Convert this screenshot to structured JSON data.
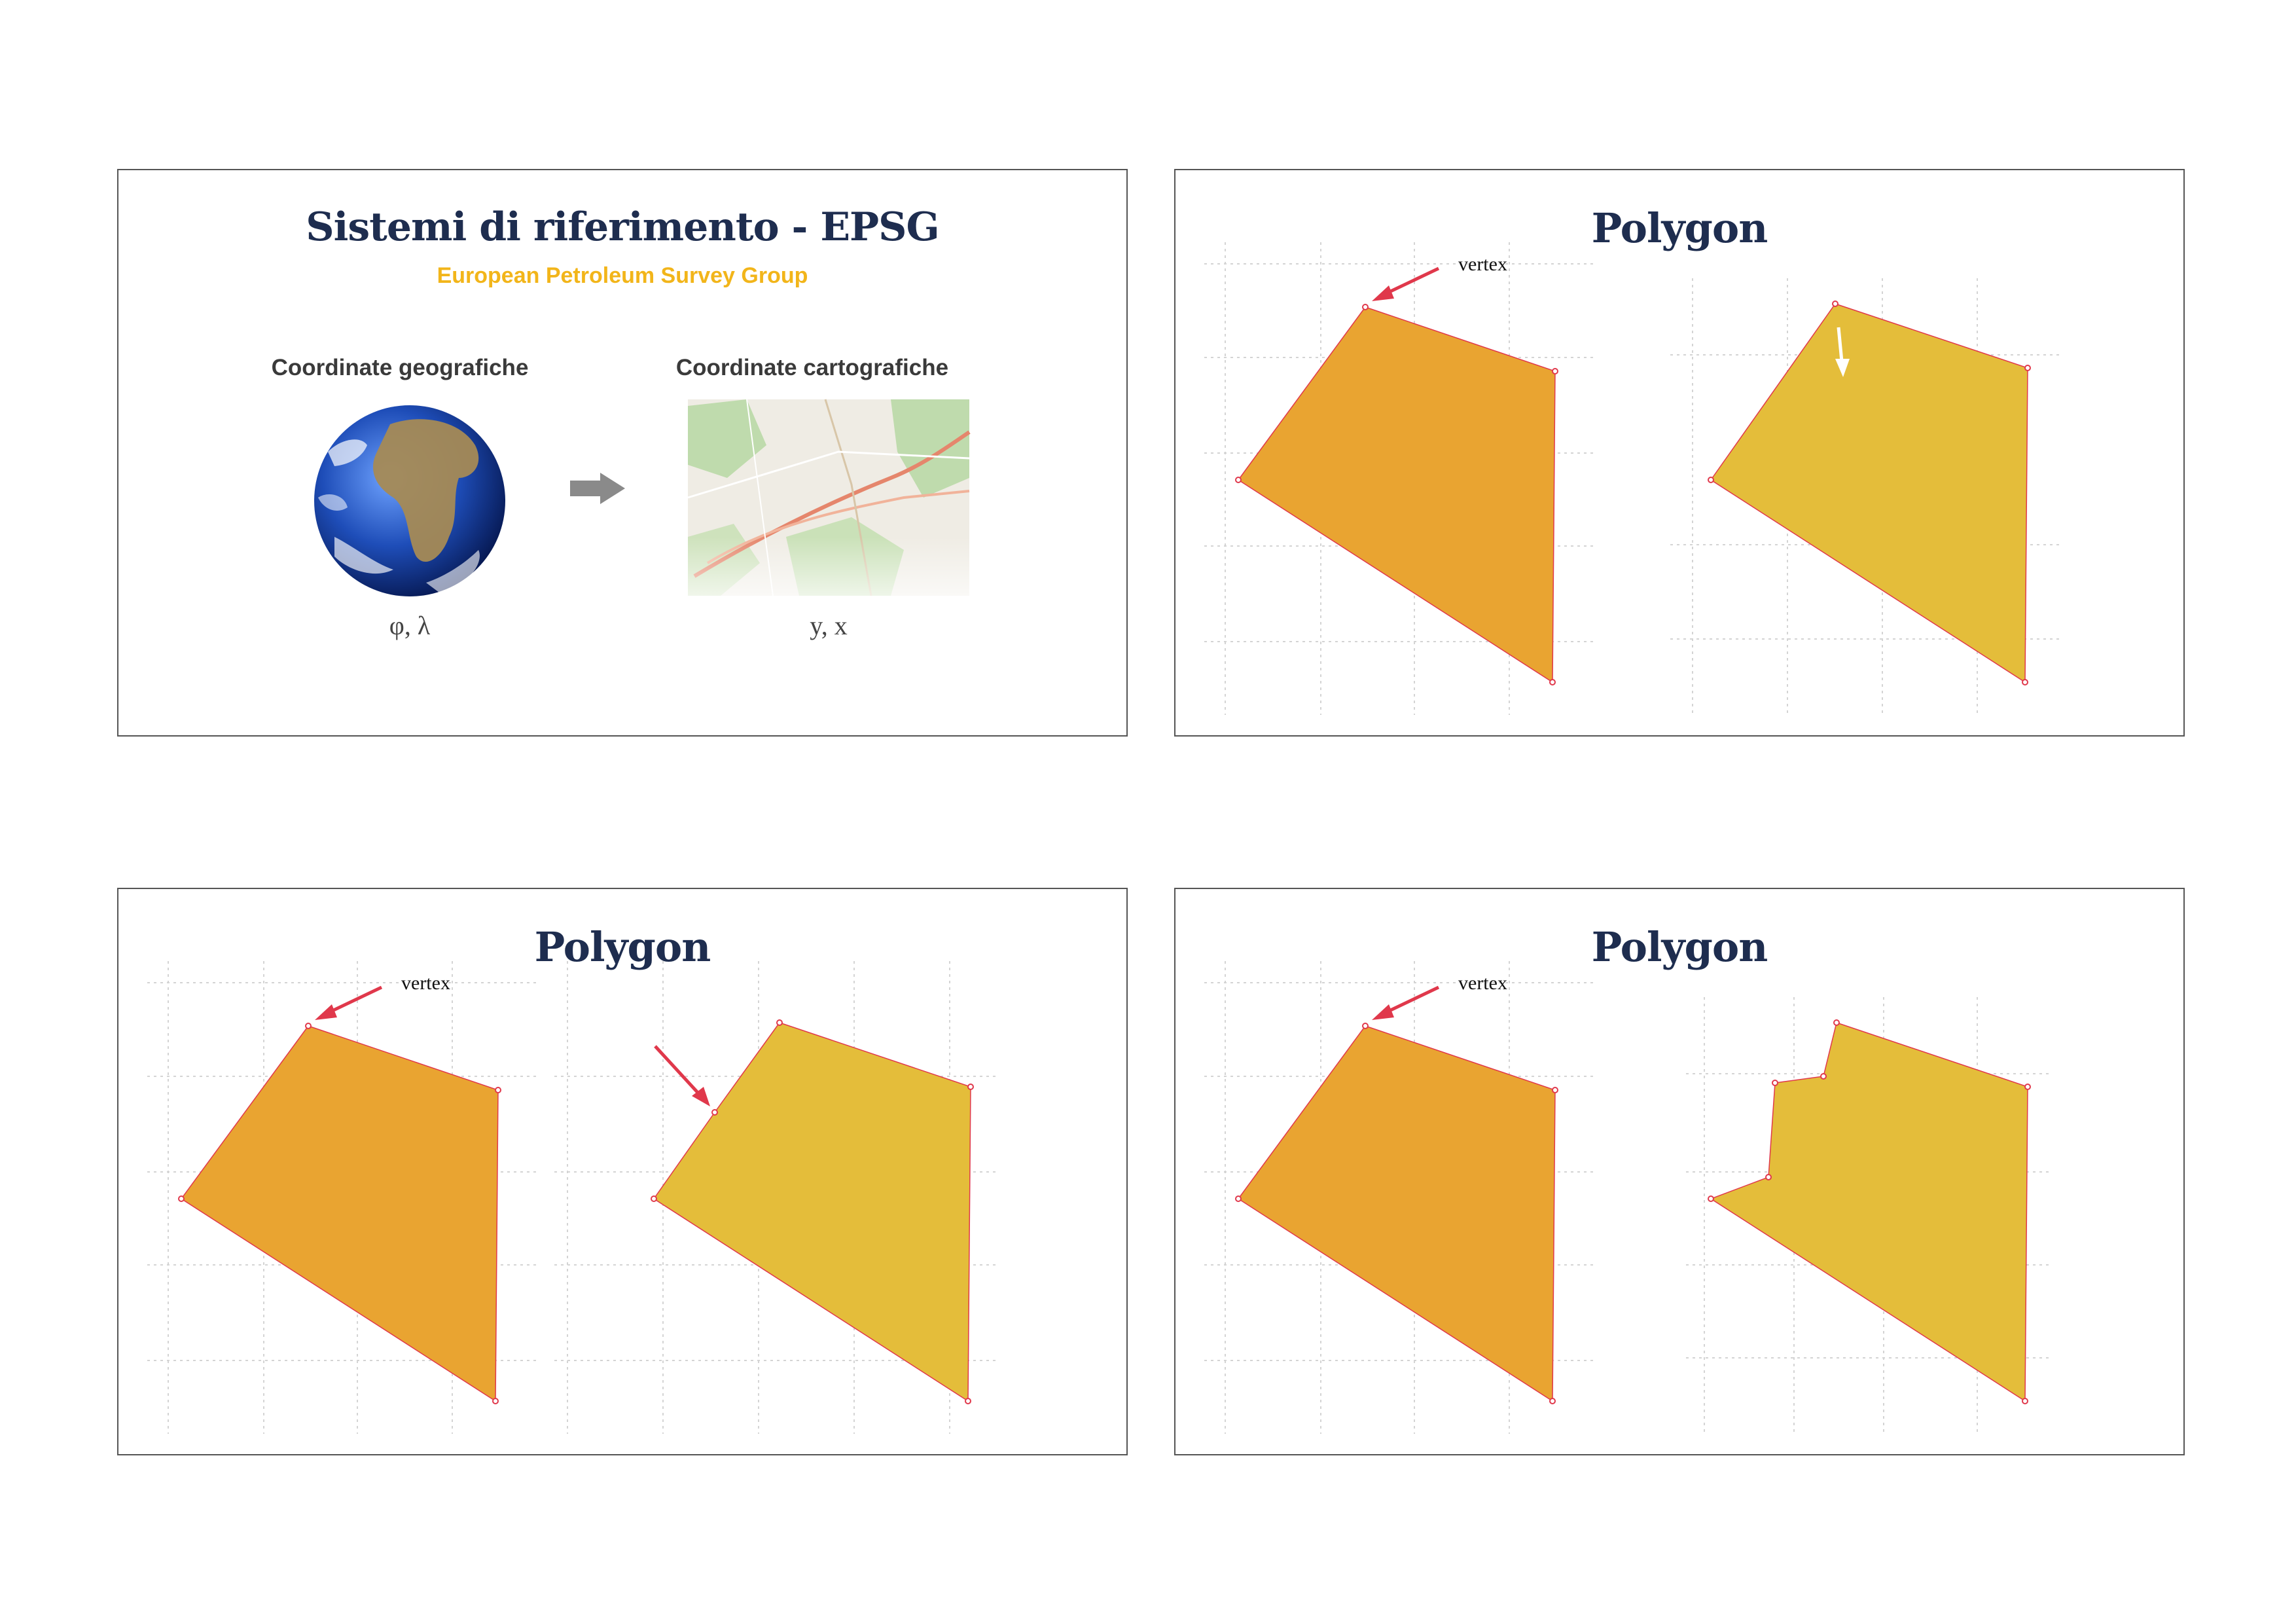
{
  "slides": [
    {
      "title": "Sistemi di riferimento - EPSG",
      "subtitle": "European Petroleum Survey Group",
      "left_heading": "Coordinate geografiche",
      "right_heading": "Coordinate cartografiche",
      "left_coords": "φ, λ",
      "right_coords": "y, x"
    },
    {
      "title": "Polygon",
      "vertex_label": "vertex"
    },
    {
      "title": "Polygon",
      "vertex_label": "vertex"
    },
    {
      "title": "Polygon",
      "vertex_label": "vertex"
    }
  ],
  "colors": {
    "title": "#1e2d4f",
    "subtitle": "#f2b51a",
    "polygon_orange": "#e9a431",
    "polygon_yellow": "#e4bd3a",
    "vertex_red": "#e0384b",
    "arrow_gray": "#8a8a8a"
  }
}
